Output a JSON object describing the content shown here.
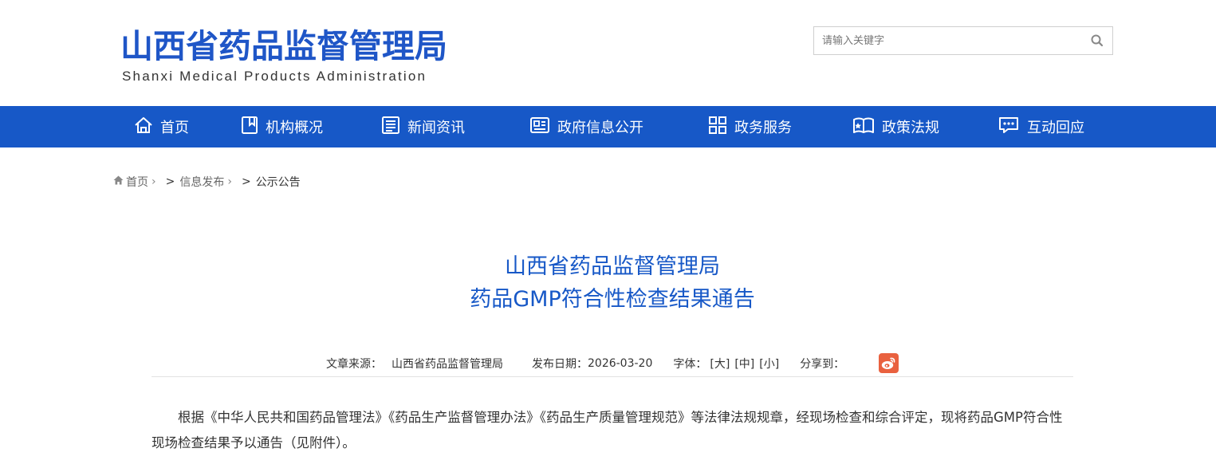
{
  "header": {
    "logo_cn": "山西省药品监督管理局",
    "logo_en": "Shanxi Medical Products Administration",
    "search": {
      "placeholder": "请输入关键字"
    }
  },
  "nav": {
    "items": [
      {
        "label": "首页",
        "icon": "home-icon"
      },
      {
        "label": "机构概况",
        "icon": "bookmark-icon"
      },
      {
        "label": "新闻资讯",
        "icon": "news-icon"
      },
      {
        "label": "政府信息公开",
        "icon": "id-card-icon"
      },
      {
        "label": "政务服务",
        "icon": "grid-icon"
      },
      {
        "label": "政策法规",
        "icon": "book-icon"
      },
      {
        "label": "互动回应",
        "icon": "chat-icon"
      }
    ]
  },
  "breadcrumb": {
    "home": "首页",
    "level1": "信息发布",
    "current": "公示公告"
  },
  "article": {
    "title_line1": "山西省药品监督管理局",
    "title_line2": "药品GMP符合性检查结果通告",
    "source_label": "文章来源：",
    "source": "山西省药品监督管理局",
    "date_label": "发布日期：",
    "date": "2026-03-20",
    "font_label": "字体：",
    "font_large": "[大]",
    "font_medium": "[中]",
    "font_small": "[小]",
    "share_label": "分享到：",
    "body": "根据《中华人民共和国药品管理法》《药品生产监督管理办法》《药品生产质量管理规范》等法律法规规章，经现场检查和综合评定，现将药品GMP符合性现场检查结果予以通告（见附件）。"
  },
  "colors": {
    "primary": "#1758c7",
    "logo": "#1f56c7",
    "weibo": "#e9613f"
  }
}
